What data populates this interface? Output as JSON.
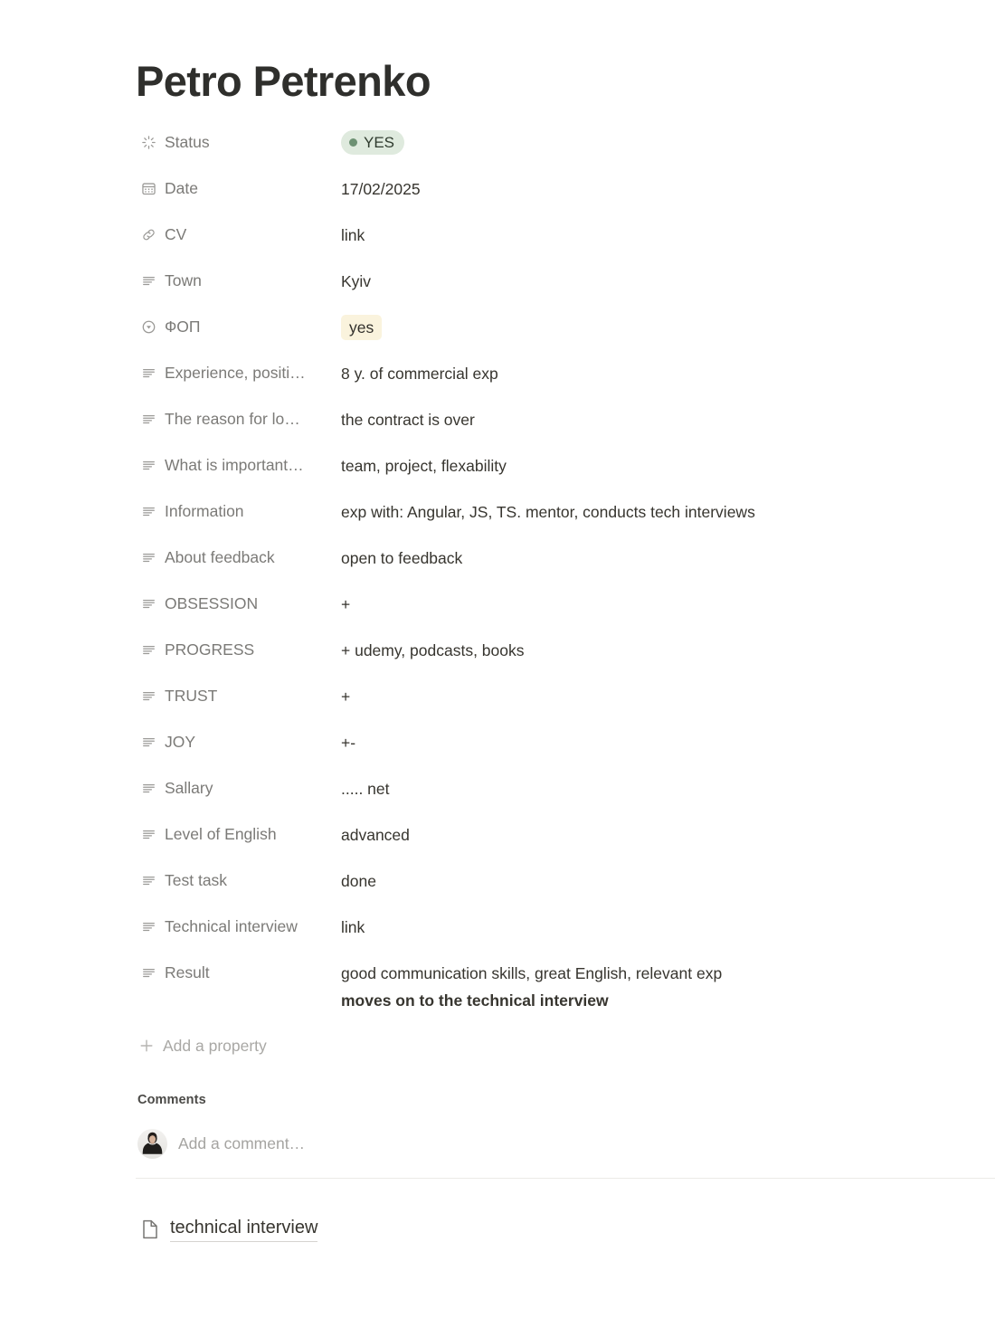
{
  "page": {
    "title": "Petro Petrenko"
  },
  "properties": [
    {
      "icon": "status-spinner-icon",
      "label": "Status",
      "value": "YES",
      "value_type": "status-pill",
      "truncated": false
    },
    {
      "icon": "calendar-icon",
      "label": "Date",
      "value": "17/02/2025",
      "value_type": "text",
      "truncated": false
    },
    {
      "icon": "link-icon",
      "label": "CV",
      "value": "link",
      "value_type": "text",
      "truncated": false
    },
    {
      "icon": "text-lines-icon",
      "label": "Town",
      "value": "Kyiv",
      "value_type": "text",
      "truncated": false
    },
    {
      "icon": "select-circle-icon",
      "label": "ФОП",
      "value": "yes",
      "value_type": "tag-yellow",
      "truncated": false
    },
    {
      "icon": "text-lines-icon",
      "label": "Experience, positi…",
      "value": "8 y. of commercial exp",
      "value_type": "text",
      "truncated": true
    },
    {
      "icon": "text-lines-icon",
      "label": "The reason for lo…",
      "value": "the contract is over",
      "value_type": "text",
      "truncated": true
    },
    {
      "icon": "text-lines-icon",
      "label": "What is important…",
      "value": "team, project, flexability",
      "value_type": "text",
      "truncated": true
    },
    {
      "icon": "text-lines-icon",
      "label": "Information",
      "value": "exp with: Angular, JS, TS. mentor, conducts tech interviews",
      "value_type": "text",
      "truncated": false
    },
    {
      "icon": "text-lines-icon",
      "label": "About feedback",
      "value": "open to feedback",
      "value_type": "text",
      "truncated": false
    },
    {
      "icon": "text-lines-icon",
      "label": "OBSESSION",
      "value": "+",
      "value_type": "text",
      "truncated": false
    },
    {
      "icon": "text-lines-icon",
      "label": "PROGRESS",
      "value": "+ udemy, podcasts, books",
      "value_type": "text",
      "truncated": false
    },
    {
      "icon": "text-lines-icon",
      "label": "TRUST",
      "value": "+",
      "value_type": "text",
      "truncated": false
    },
    {
      "icon": "text-lines-icon",
      "label": "JOY",
      "value": "+-",
      "value_type": "text",
      "truncated": false
    },
    {
      "icon": "text-lines-icon",
      "label": "Sallary",
      "value": "..... net",
      "value_type": "text",
      "truncated": false
    },
    {
      "icon": "text-lines-icon",
      "label": "Level of English",
      "value": "advanced",
      "value_type": "text",
      "truncated": false
    },
    {
      "icon": "text-lines-icon",
      "label": "Test task",
      "value": "done",
      "value_type": "text",
      "truncated": false
    },
    {
      "icon": "text-lines-icon",
      "label": "Technical interview",
      "value": "link",
      "value_type": "text",
      "truncated": false
    },
    {
      "icon": "text-lines-icon",
      "label": "Result",
      "value": "good communication skills, great English, relevant exp",
      "value_line2": "moves on to the technical interview",
      "value_type": "multiline",
      "truncated": false
    }
  ],
  "add_property": {
    "label": "Add a property",
    "icon": "plus-icon"
  },
  "comments": {
    "heading": "Comments",
    "placeholder": "Add a comment…",
    "avatar_icon": "user-avatar-photo"
  },
  "page_link": {
    "label": "technical interview",
    "icon": "page-document-icon"
  },
  "colors": {
    "status_pill_bg": "#dfeade",
    "status_dot": "#6d9173",
    "tag_yellow_bg": "#faf3dd",
    "label_text": "#7b7a77",
    "value_text": "#37352f",
    "icon_gray": "#9b9a97",
    "divider": "#eceae6"
  }
}
